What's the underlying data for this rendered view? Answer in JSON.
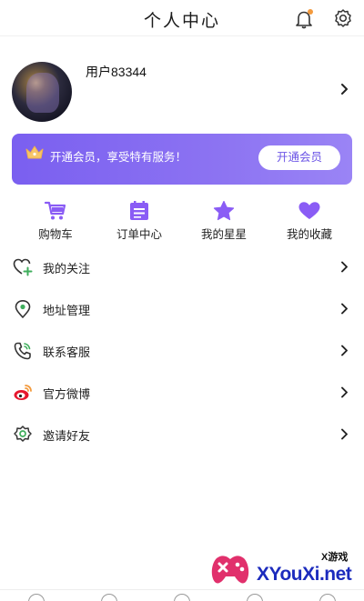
{
  "header": {
    "title": "个人中心",
    "notification_icon": "bell-icon",
    "settings_icon": "gear-icon",
    "notification_dot_color": "#f39a3d"
  },
  "profile": {
    "username": "用户83344",
    "avatar_icon": "avatar"
  },
  "vip_banner": {
    "text": "开通会员，享受特有服务！",
    "button_label": "开通会员",
    "icon": "crown-icon",
    "color": "#7a5ff0"
  },
  "quick_actions": [
    {
      "label": "购物车",
      "icon": "cart-icon"
    },
    {
      "label": "订单中心",
      "icon": "order-icon"
    },
    {
      "label": "我的星星",
      "icon": "star-icon"
    },
    {
      "label": "我的收藏",
      "icon": "heart-icon"
    }
  ],
  "menu": [
    {
      "label": "我的关注",
      "icon": "heart-plus-icon"
    },
    {
      "label": "地址管理",
      "icon": "location-icon"
    },
    {
      "label": "联系客服",
      "icon": "phone-icon"
    },
    {
      "label": "官方微博",
      "icon": "weibo-icon"
    },
    {
      "label": "邀请好友",
      "icon": "flower-icon"
    }
  ],
  "watermark": {
    "sub": "X游戏",
    "brand": "XYouXi.net"
  },
  "accent_color": "#8a5cf5"
}
